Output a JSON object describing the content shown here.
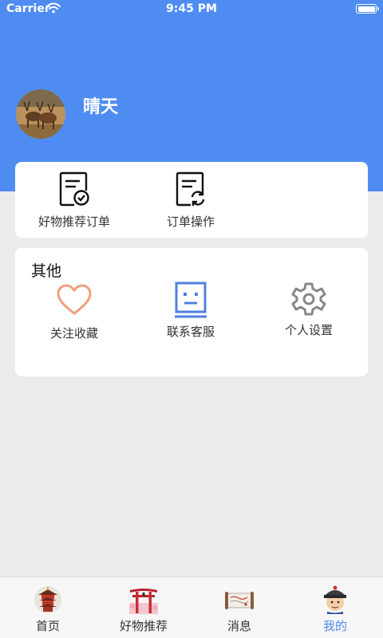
{
  "status_bar": {
    "carrier": "Carrier",
    "time": "9:45 PM"
  },
  "profile": {
    "name": "晴天"
  },
  "orders": [
    {
      "label": "好物推荐订单",
      "icon": "order-check-icon"
    },
    {
      "label": "订单操作",
      "icon": "order-refresh-icon"
    }
  ],
  "other": {
    "title": "其他",
    "items": [
      {
        "label": "关注收藏",
        "icon": "heart-icon",
        "color": "#f2a07b"
      },
      {
        "label": "联系客服",
        "icon": "robot-service-icon",
        "color": "#4f7fe0"
      },
      {
        "label": "个人设置",
        "icon": "gear-icon",
        "color": "#888888"
      }
    ]
  },
  "tabs": [
    {
      "label": "首页",
      "icon": "pagoda-icon",
      "active": false
    },
    {
      "label": "好物推荐",
      "icon": "torii-gate-icon",
      "active": false
    },
    {
      "label": "消息",
      "icon": "scroll-icon",
      "active": false
    },
    {
      "label": "我的",
      "icon": "qing-official-icon",
      "active": true
    }
  ],
  "colors": {
    "header_blue": "#4f8cf2",
    "active_tab": "#4f8cf2",
    "background": "#ececec"
  }
}
